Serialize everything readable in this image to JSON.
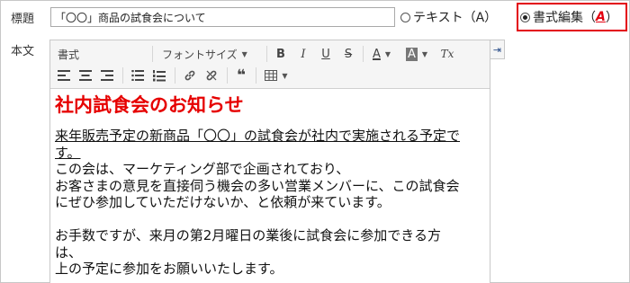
{
  "form": {
    "subject_label": "標題",
    "subject_value": "「〇〇」商品の試食会について",
    "body_label": "本文"
  },
  "mode": {
    "text_option": "テキスト（A）",
    "rich_option_text": "書式編集（",
    "rich_option_key": "A",
    "rich_option_close": "）",
    "selected": "rich"
  },
  "toolbar": {
    "format_select": "書式",
    "font_size_select": "フォントサイズ",
    "bold": "B",
    "italic": "I",
    "underline": "U",
    "strike": "S",
    "text_color": "A",
    "bg_color": "A",
    "clear_format": "Tx",
    "quote": "❝"
  },
  "body": {
    "heading": "社内試食会のお知らせ",
    "line1": "来年販売予定の新商品「〇〇」の試食会が社内で実施される予定で",
    "line1b": "す。",
    "line2": "この会は、マーケティング部で企画されており、",
    "line3": "お客さまの意見を直接伺う機会の多い営業メンバーに、この試食会",
    "line4": "にぜひ参加していただけないか、と依頼が来ています。",
    "line5": "お手数ですが、来月の第2月曜日の業後に試食会に参加できる方",
    "line5b": "は、",
    "line6": "上の予定に参加をお願いいたします。"
  },
  "colors": {
    "highlight_border": "#e3000f",
    "heading": "#e60000"
  }
}
